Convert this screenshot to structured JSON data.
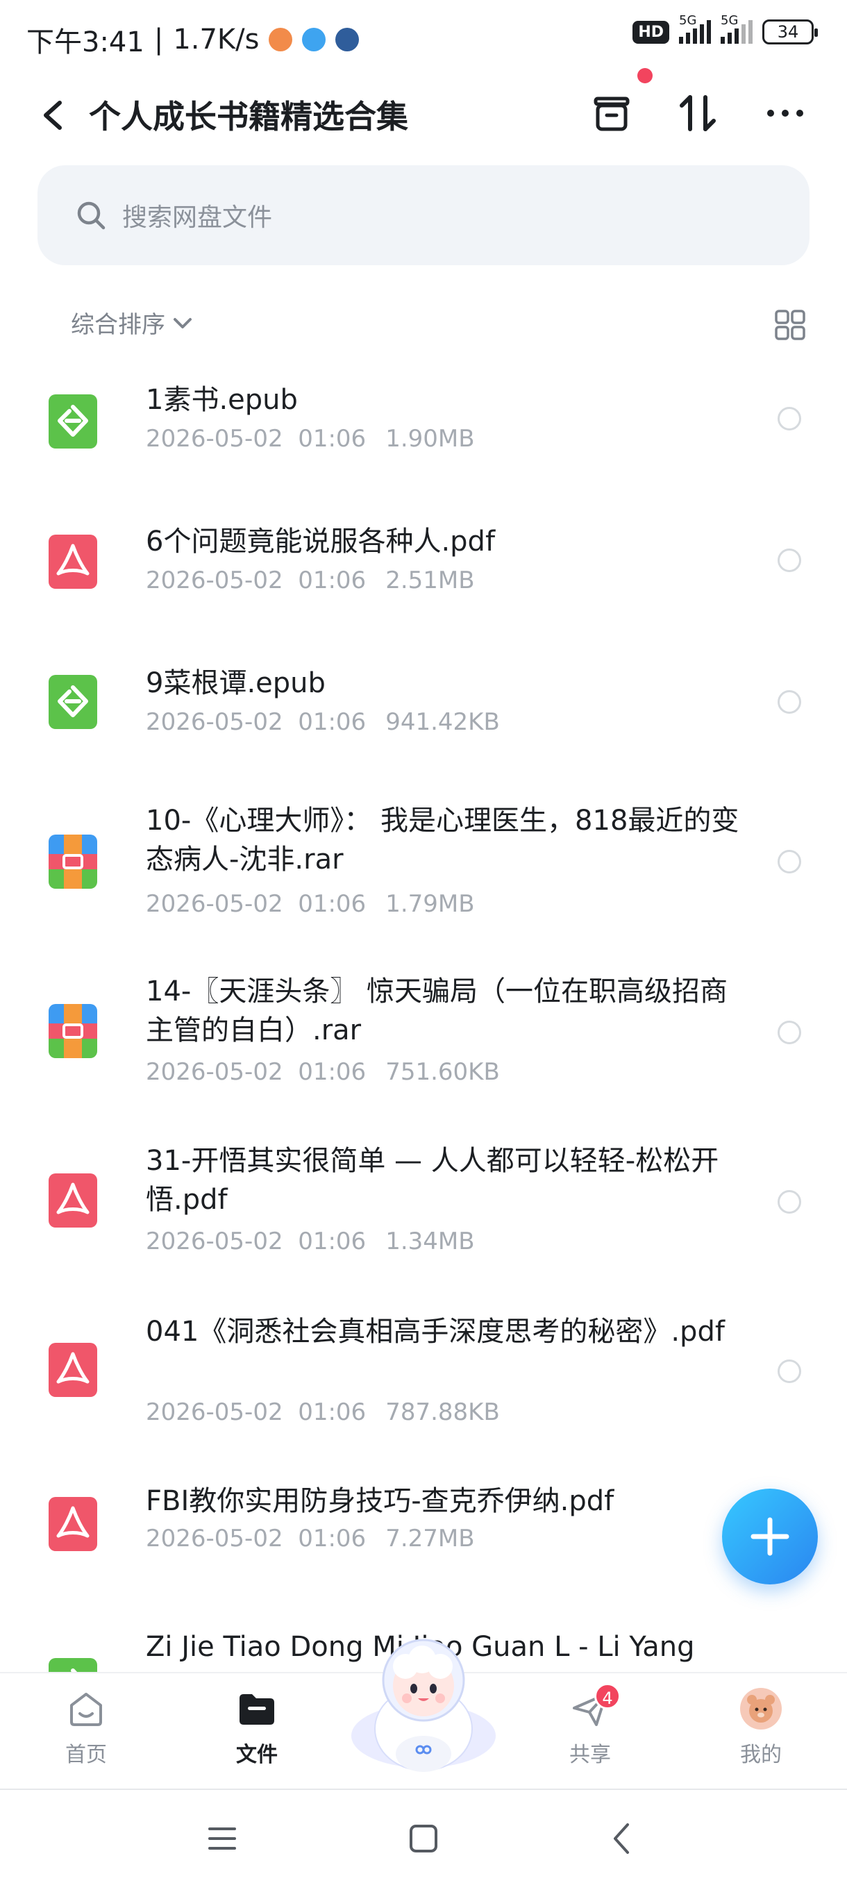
{
  "status_bar": {
    "time": "下午3:41",
    "speed": "1.7K/s",
    "hd_label": "HD",
    "signal1_label": "5G",
    "signal2_label": "5G",
    "battery": "34"
  },
  "header": {
    "title": "个人成长书籍精选合集",
    "back_icon": "chevron-left-icon",
    "icons": [
      "transfer-box-icon",
      "sort-arrows-icon",
      "more-dots-icon"
    ]
  },
  "search": {
    "placeholder": "搜索网盘文件"
  },
  "sort": {
    "label": "综合排序"
  },
  "files": [
    {
      "name": "1素书.epub",
      "date": "2026-05-02  01:06",
      "size": "1.90MB",
      "type": "epub"
    },
    {
      "name": "6个问题竟能说服各种人.pdf",
      "date": "2026-05-02  01:06",
      "size": "2.51MB",
      "type": "pdf"
    },
    {
      "name": "9菜根谭.epub",
      "date": "2026-05-02  01:06",
      "size": "941.42KB",
      "type": "epub"
    },
    {
      "name": "10-《心理大师》： 我是心理医生，818最近的变态病人-沈非.rar",
      "date": "2026-05-02  01:06",
      "size": "1.79MB",
      "type": "rar"
    },
    {
      "name": "14-〖天涯头条〗 惊天骗局（一位在职高级招商主管的自白）.rar",
      "date": "2026-05-02  01:06",
      "size": "751.60KB",
      "type": "rar"
    },
    {
      "name": "31-开悟其实很简单 — 人人都可以轻轻-松松开悟.pdf",
      "date": "2026-05-02  01:06",
      "size": "1.34MB",
      "type": "pdf"
    },
    {
      "name": "041《洞悉社会真相高手深度思考的秘密》.pdf",
      "date": "2026-05-02  01:06",
      "size": "787.88KB",
      "type": "pdf"
    },
    {
      "name": "FBI教你实用防身技巧-查克乔伊纳.pdf",
      "date": "2026-05-02  01:06",
      "size": "7.27MB",
      "type": "pdf"
    },
    {
      "name": "Zi Jie Tiao Dong Mi Jiao Guan L - Li Yang",
      "date": "",
      "size": "",
      "type": "epub"
    }
  ],
  "bottom_nav": {
    "items": [
      {
        "label": "首页",
        "icon": "home-icon"
      },
      {
        "label": "文件",
        "icon": "folder-icon"
      },
      {
        "label": "共享",
        "icon": "send-icon",
        "badge": "4"
      },
      {
        "label": "我的",
        "icon": "avatar-icon"
      }
    ]
  },
  "colors": {
    "accent": "#2a86f0",
    "pdf": "#f0566a",
    "epub": "#5cc24a",
    "badge": "#f2445e"
  }
}
